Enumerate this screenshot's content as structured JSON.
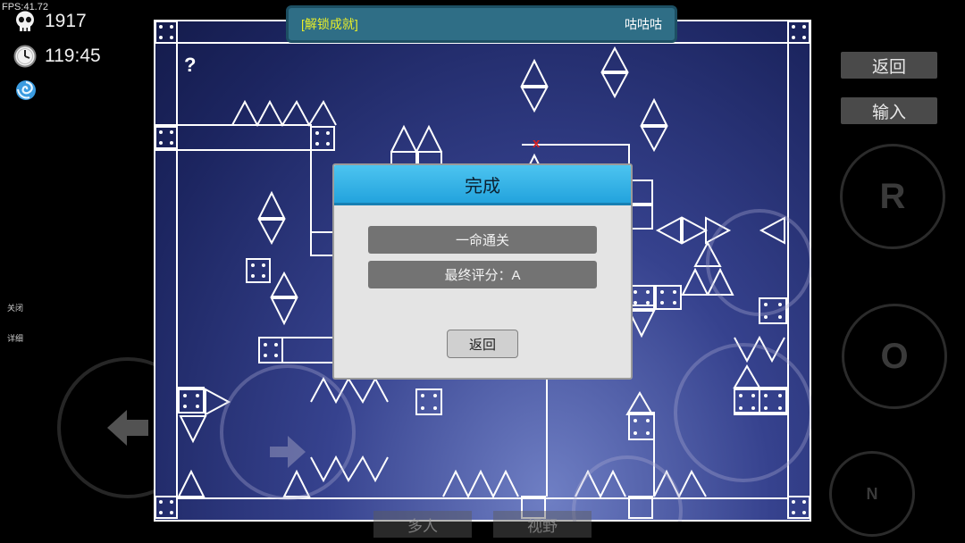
{
  "hud": {
    "fps": "FPS:41.72",
    "deaths": "1917",
    "time": "119:45",
    "side_close": "关闭",
    "side_detail": "详细"
  },
  "banner": {
    "tag": "[解锁成就]",
    "player_name": "咕咕咕"
  },
  "right_panel": {
    "back_label": "返回",
    "input_label": "输入",
    "r_button": "R",
    "o_button": "O",
    "n_button": "N"
  },
  "bottom": {
    "multiplayer_label": "多人",
    "view_label": "视野"
  },
  "game": {
    "question_mark": "?",
    "marker": "x"
  },
  "dialog": {
    "title": "完成",
    "line1": "一命通关",
    "line2": "最终评分：A",
    "back_label": "返回"
  },
  "icons": {
    "deaths": "skull-icon",
    "time": "clock-icon",
    "mode": "swirl-icon",
    "left": "arrow-left-icon",
    "right": "arrow-right-icon"
  },
  "colors": {
    "banner_bg": "#2f6e86",
    "banner_tag": "#e8ee2a",
    "dialog_header": "#23a3dd",
    "dialog_row": "#737373",
    "game_bg": "#1c2560"
  }
}
